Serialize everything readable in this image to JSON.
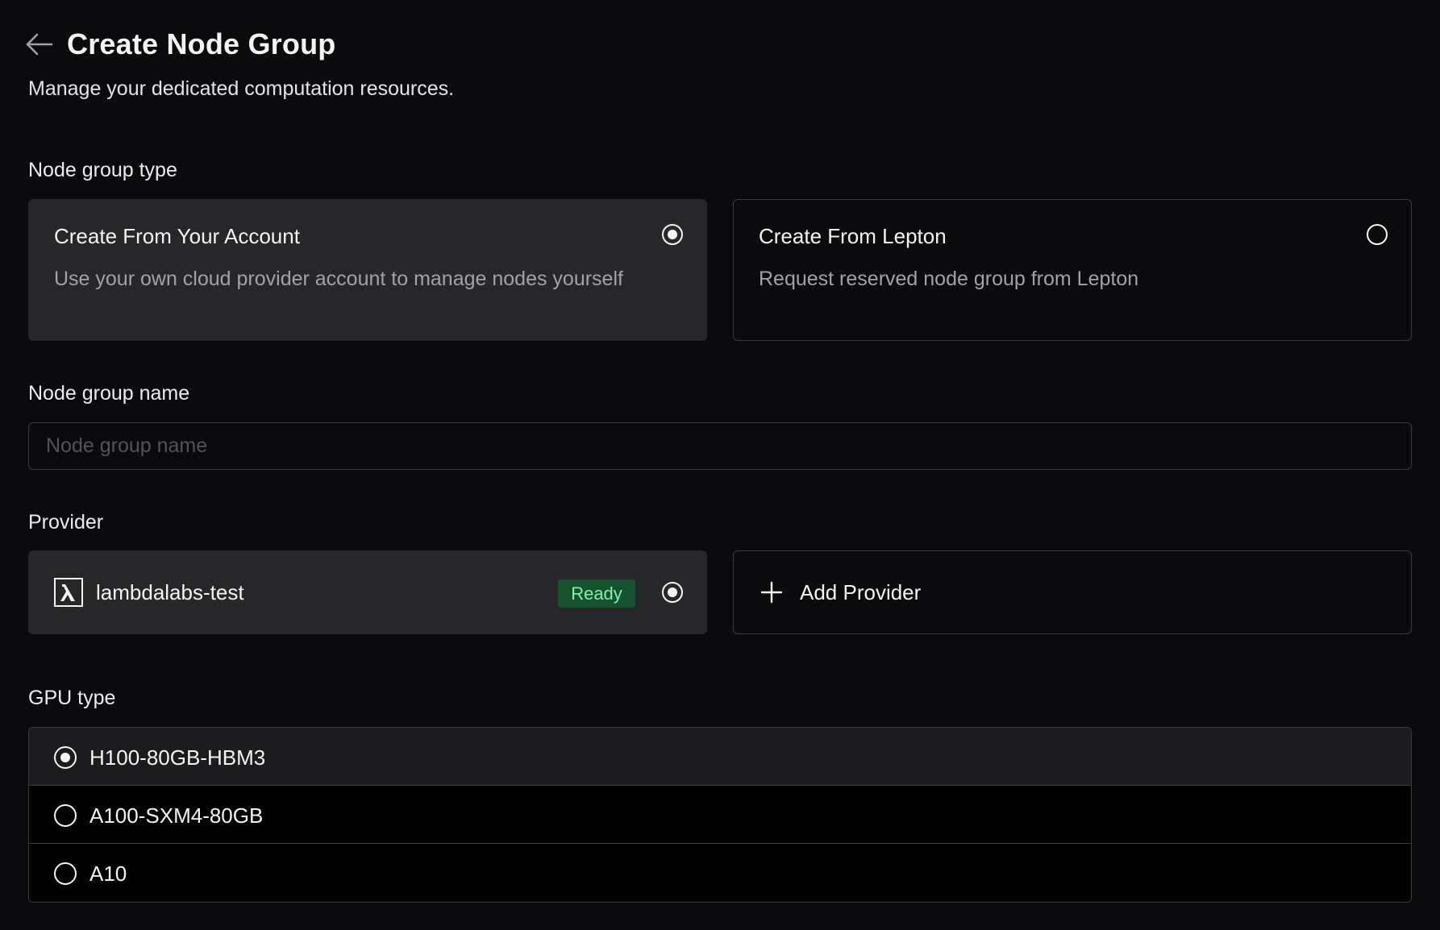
{
  "header": {
    "title": "Create Node Group",
    "subtitle": "Manage your dedicated computation resources.",
    "back_icon": "arrow-left-icon"
  },
  "node_group_type": {
    "label": "Node group type",
    "options": [
      {
        "title": "Create From Your Account",
        "description": "Use your own cloud provider account to manage nodes yourself",
        "selected": true
      },
      {
        "title": "Create From Lepton",
        "description": "Request reserved node group from Lepton",
        "selected": false
      }
    ]
  },
  "node_group_name": {
    "label": "Node group name",
    "value": "",
    "placeholder": "Node group name"
  },
  "provider": {
    "label": "Provider",
    "items": [
      {
        "name": "lambdalabs-test",
        "icon": "lambda-icon",
        "status": "Ready",
        "status_color": "#86efac",
        "selected": true
      }
    ],
    "add_label": "Add Provider",
    "add_icon": "plus-icon"
  },
  "gpu_type": {
    "label": "GPU type",
    "options": [
      {
        "label": "H100-80GB-HBM3",
        "selected": true
      },
      {
        "label": "A100-SXM4-80GB",
        "selected": false
      },
      {
        "label": "A10",
        "selected": false
      }
    ]
  }
}
